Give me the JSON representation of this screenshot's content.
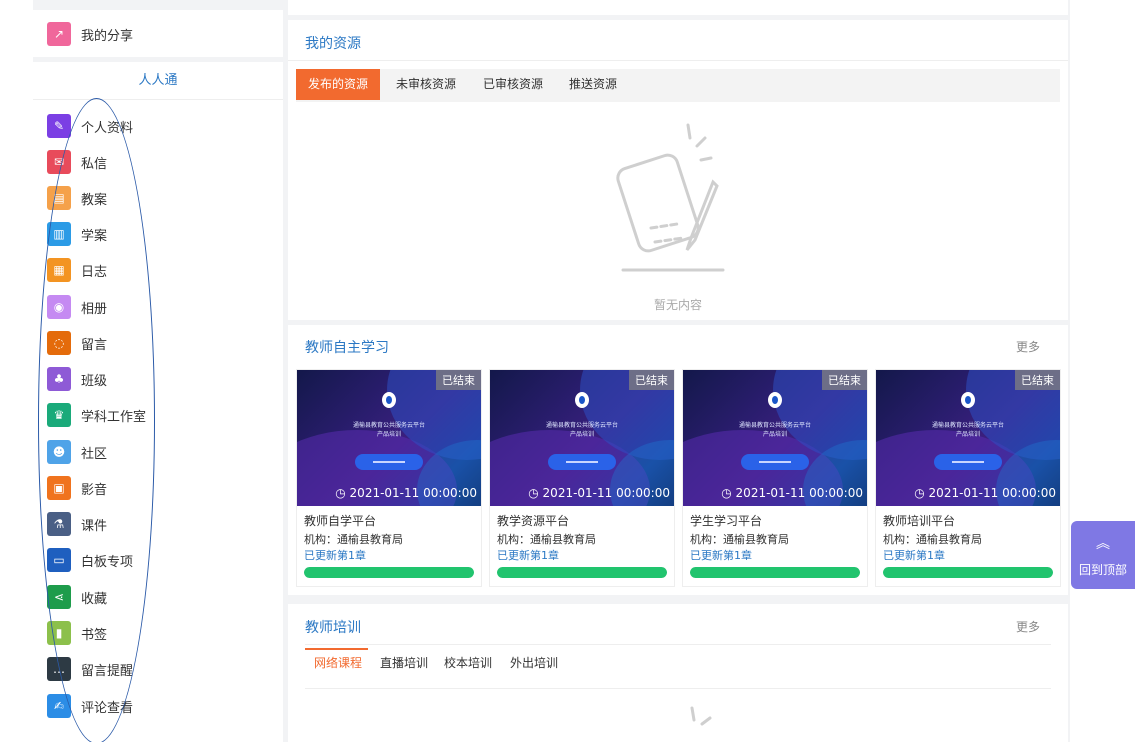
{
  "sidebar": {
    "share_label": "我的分享",
    "title": "人人通",
    "items": [
      {
        "label": "个人资料",
        "icon": "graduation-cap-icon",
        "color": "#7b3fe4",
        "glyph": "✎"
      },
      {
        "label": "私信",
        "icon": "mail-icon",
        "color": "#e84b5b",
        "glyph": "✉"
      },
      {
        "label": "教案",
        "icon": "book-plan-icon",
        "color": "#f5a14a",
        "glyph": "▤"
      },
      {
        "label": "学案",
        "icon": "open-book-icon",
        "color": "#2b9be6",
        "glyph": "▥"
      },
      {
        "label": "日志",
        "icon": "journal-icon",
        "color": "#f39422",
        "glyph": "▦"
      },
      {
        "label": "相册",
        "icon": "camera-icon",
        "color": "#c58af2",
        "glyph": "◉"
      },
      {
        "label": "留言",
        "icon": "chat-bubble-icon",
        "color": "#e46b0b",
        "glyph": "◌"
      },
      {
        "label": "班级",
        "icon": "class-icon",
        "color": "#8e5ad6",
        "glyph": "♣"
      },
      {
        "label": "学科工作室",
        "icon": "trophy-icon",
        "color": "#1aaa7a",
        "glyph": "♛"
      },
      {
        "label": "社区",
        "icon": "users-icon",
        "color": "#4fa3e8",
        "glyph": "☻"
      },
      {
        "label": "影音",
        "icon": "film-icon",
        "color": "#f0731e",
        "glyph": "▣"
      },
      {
        "label": "课件",
        "icon": "flask-icon",
        "color": "#4a5f85",
        "glyph": "⚗"
      },
      {
        "label": "白板专项",
        "icon": "monitor-icon",
        "color": "#1f5fbf",
        "glyph": "▭"
      },
      {
        "label": "收藏",
        "icon": "share-nodes-icon",
        "color": "#1e9c4b",
        "glyph": "⋖"
      },
      {
        "label": "书签",
        "icon": "notebook-icon",
        "color": "#8cc04b",
        "glyph": "▮"
      },
      {
        "label": "留言提醒",
        "icon": "speech-icon",
        "color": "#2d3a44",
        "glyph": "…"
      },
      {
        "label": "评论查看",
        "icon": "comment-edit-icon",
        "color": "#2b8de6",
        "glyph": "✍"
      }
    ]
  },
  "resources": {
    "title": "我的资源",
    "tabs": [
      "发布的资源",
      "未审核资源",
      "已审核资源",
      "推送资源"
    ],
    "empty_text": "暂无内容"
  },
  "study": {
    "title": "教师自主学习",
    "more": "更多",
    "thumb_line1": "通榆县教育公共服务云平台",
    "thumb_line2": "产品培训",
    "courses": [
      {
        "name": "教师自学平台",
        "badge": "已结束",
        "time": "2021-01-11 00:00:00",
        "org": "机构：通榆县教育局",
        "update": "已更新第1章",
        "progress": 100
      },
      {
        "name": "教学资源平台",
        "badge": "已结束",
        "time": "2021-01-11 00:00:00",
        "org": "机构：通榆县教育局",
        "update": "已更新第1章",
        "progress": 100
      },
      {
        "name": "学生学习平台",
        "badge": "已结束",
        "time": "2021-01-11 00:00:00",
        "org": "机构：通榆县教育局",
        "update": "已更新第1章",
        "progress": 100
      },
      {
        "name": "教师培训平台",
        "badge": "已结束",
        "time": "2021-01-11 00:00:00",
        "org": "机构：通榆县教育局",
        "update": "已更新第1章",
        "progress": 100
      }
    ]
  },
  "training": {
    "title": "教师培训",
    "more": "更多",
    "tabs": [
      "网络课程",
      "直播培训",
      "校本培训",
      "外出培训"
    ]
  },
  "back_to_top": {
    "label": "回到顶部"
  },
  "colors": {
    "accent": "#f26a2f",
    "link": "#2b78c4",
    "progress": "#21c46e",
    "float_button": "#7f78e4"
  }
}
